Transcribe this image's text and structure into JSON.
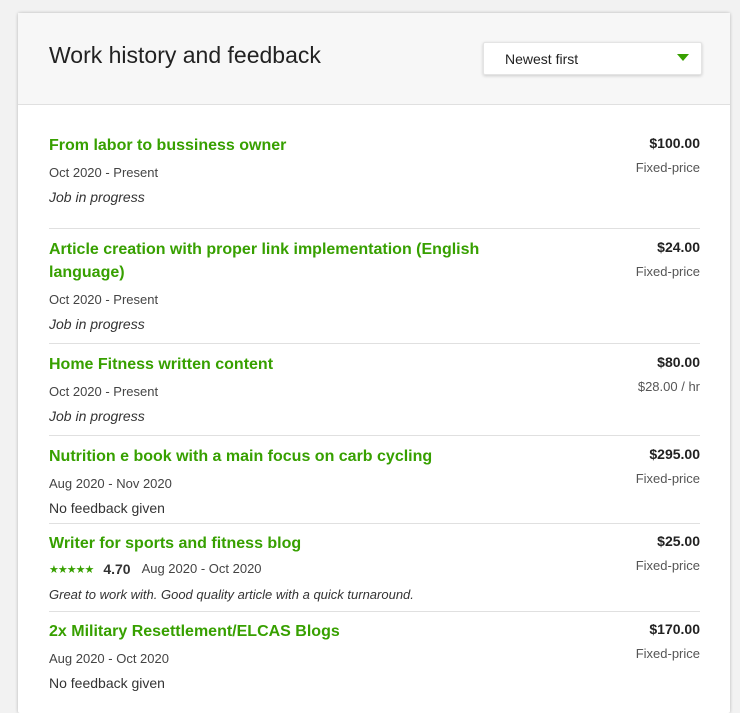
{
  "header": {
    "title": "Work history and feedback",
    "sort_label": "Newest first"
  },
  "jobs": [
    {
      "title": "From labor to bussiness owner",
      "dates": "Oct 2020 - Present",
      "feedback": "Job in progress",
      "amount": "$100.00",
      "type": "Fixed-price"
    },
    {
      "title": "Article creation with proper link implementation (English language)",
      "dates": "Oct 2020 - Present",
      "feedback": "Job in progress",
      "amount": "$24.00",
      "type": "Fixed-price"
    },
    {
      "title": "Home Fitness written content",
      "dates": "Oct 2020 - Present",
      "feedback": "Job in progress",
      "amount": "$80.00",
      "type": "$28.00 / hr"
    },
    {
      "title": "Nutrition e book with a main focus on carb cycling",
      "dates": "Aug 2020 - Nov 2020",
      "feedback": "No feedback given",
      "amount": "$295.00",
      "type": "Fixed-price"
    },
    {
      "title": "Writer for sports and fitness blog",
      "rating": "4.70",
      "stars": 5,
      "dates": "Aug 2020 - Oct 2020",
      "feedback": "Great to work with. Good quality article with a quick turnaround.",
      "amount": "$25.00",
      "type": "Fixed-price"
    },
    {
      "title": "2x Military Resettlement/ELCAS Blogs",
      "dates": "Aug 2020 - Oct 2020",
      "feedback": "No feedback given",
      "amount": "$170.00",
      "type": "Fixed-price"
    }
  ],
  "colors": {
    "accent": "#37a000",
    "star": "#37a000"
  },
  "icons": {
    "sort_caret": "caret-down-icon",
    "star": "star-icon"
  }
}
